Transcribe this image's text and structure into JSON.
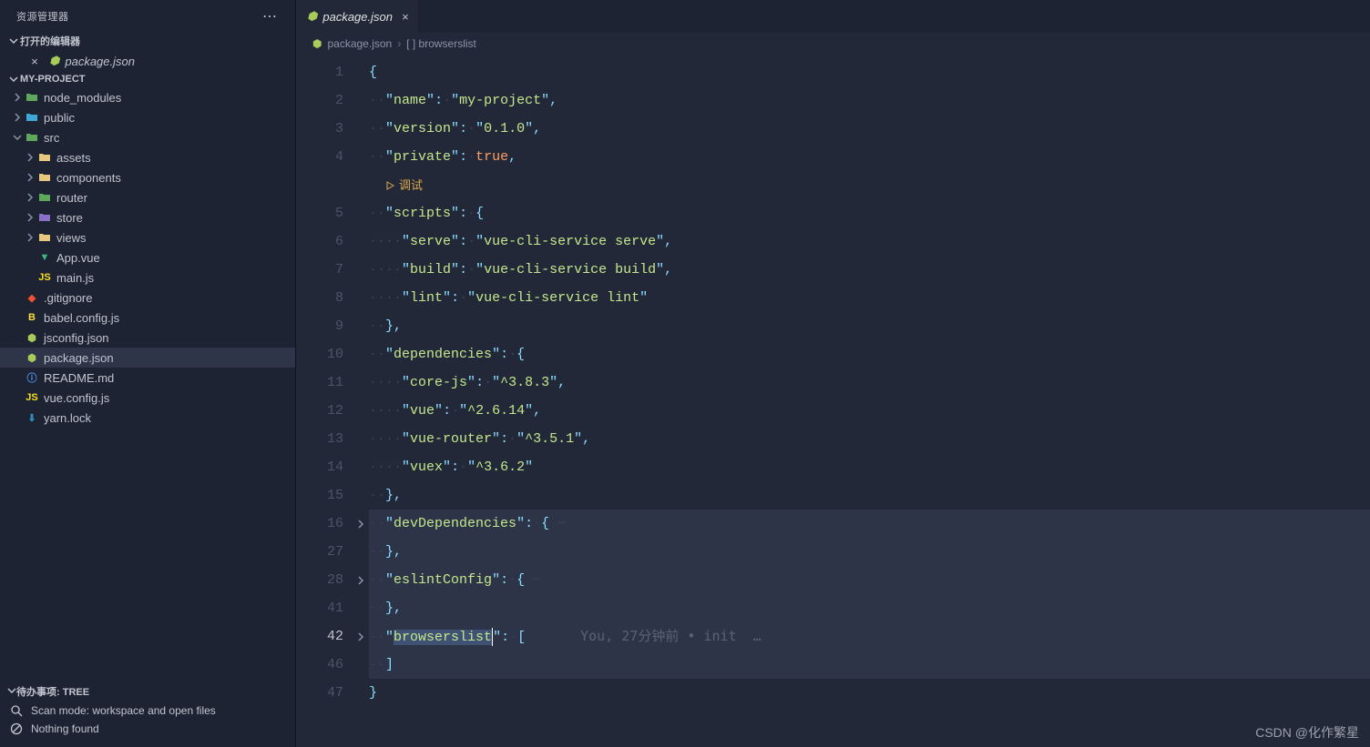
{
  "sidebar": {
    "title": "资源管理器",
    "open_editors_label": "打开的编辑器",
    "open_editors": [
      {
        "label": "package.json"
      }
    ],
    "project_label": "MY-PROJECT",
    "tree": [
      {
        "label": "node_modules",
        "depth": 1,
        "kind": "folder",
        "iconCls": "icon-folder-g",
        "expanded": false
      },
      {
        "label": "public",
        "depth": 1,
        "kind": "folder",
        "iconCls": "icon-folder",
        "expanded": false
      },
      {
        "label": "src",
        "depth": 1,
        "kind": "folder",
        "iconCls": "icon-folder-g",
        "expanded": true
      },
      {
        "label": "assets",
        "depth": 2,
        "kind": "folder",
        "iconCls": "icon-folder-o",
        "expanded": false
      },
      {
        "label": "components",
        "depth": 2,
        "kind": "folder",
        "iconCls": "icon-folder-o",
        "expanded": false
      },
      {
        "label": "router",
        "depth": 2,
        "kind": "folder",
        "iconCls": "icon-folder-g",
        "expanded": false
      },
      {
        "label": "store",
        "depth": 2,
        "kind": "folder",
        "iconCls": "icon-folder-v",
        "expanded": false
      },
      {
        "label": "views",
        "depth": 2,
        "kind": "folder",
        "iconCls": "icon-folder-o",
        "expanded": false
      },
      {
        "label": "App.vue",
        "depth": 2,
        "kind": "file",
        "iconCls": "icon-vue"
      },
      {
        "label": "main.js",
        "depth": 2,
        "kind": "file",
        "iconCls": "icon-js"
      },
      {
        "label": ".gitignore",
        "depth": 1,
        "kind": "file",
        "iconCls": "icon-git"
      },
      {
        "label": "babel.config.js",
        "depth": 1,
        "kind": "file",
        "iconCls": "icon-babel"
      },
      {
        "label": "jsconfig.json",
        "depth": 1,
        "kind": "file",
        "iconCls": "icon-json"
      },
      {
        "label": "package.json",
        "depth": 1,
        "kind": "file",
        "iconCls": "icon-json",
        "selected": true
      },
      {
        "label": "README.md",
        "depth": 1,
        "kind": "file",
        "iconCls": "icon-md"
      },
      {
        "label": "vue.config.js",
        "depth": 1,
        "kind": "file",
        "iconCls": "icon-js"
      },
      {
        "label": "yarn.lock",
        "depth": 1,
        "kind": "file",
        "iconCls": "icon-yarn"
      }
    ],
    "footer": {
      "todo_label": "待办事项: TREE",
      "scan_label": "Scan mode: workspace and open files",
      "nothing_label": "Nothing found"
    }
  },
  "tabs": [
    {
      "label": "package.json"
    }
  ],
  "breadcrumb": {
    "file": "package.json",
    "path": "[ ] browserslist"
  },
  "codelens": {
    "debug": "调试"
  },
  "blame": {
    "text": "You, 27分钟前 • init  …"
  },
  "code": {
    "lines": [
      {
        "n": 1,
        "type": "brace",
        "text": "{"
      },
      {
        "n": 2,
        "type": "kv",
        "indent": 1,
        "key": "name",
        "val": "my-project",
        "comma": true
      },
      {
        "n": 3,
        "type": "kv",
        "indent": 1,
        "key": "version",
        "val": "0.1.0",
        "comma": true
      },
      {
        "n": 4,
        "type": "kvkw",
        "indent": 1,
        "key": "private",
        "kw": "true",
        "comma": true
      },
      {
        "n": 0,
        "type": "lens"
      },
      {
        "n": 5,
        "type": "kobj",
        "indent": 1,
        "key": "scripts"
      },
      {
        "n": 6,
        "type": "kv",
        "indent": 2,
        "key": "serve",
        "val": "vue-cli-service serve",
        "comma": true
      },
      {
        "n": 7,
        "type": "kv",
        "indent": 2,
        "key": "build",
        "val": "vue-cli-service build",
        "comma": true
      },
      {
        "n": 8,
        "type": "kv",
        "indent": 2,
        "key": "lint",
        "val": "vue-cli-service lint"
      },
      {
        "n": 9,
        "type": "close",
        "indent": 1,
        "text": "},",
        "comma": true
      },
      {
        "n": 10,
        "type": "kobj",
        "indent": 1,
        "key": "dependencies"
      },
      {
        "n": 11,
        "type": "kv",
        "indent": 2,
        "key": "core-js",
        "val": "^3.8.3",
        "comma": true
      },
      {
        "n": 12,
        "type": "kv",
        "indent": 2,
        "key": "vue",
        "val": "^2.6.14",
        "comma": true
      },
      {
        "n": 13,
        "type": "kv",
        "indent": 2,
        "key": "vue-router",
        "val": "^3.5.1",
        "comma": true
      },
      {
        "n": 14,
        "type": "kv",
        "indent": 2,
        "key": "vuex",
        "val": "^3.6.2"
      },
      {
        "n": 15,
        "type": "close",
        "indent": 1,
        "text": "},",
        "comma": true
      },
      {
        "n": 16,
        "type": "kobjfold",
        "indent": 1,
        "key": "devDependencies",
        "fold": true,
        "hl": true
      },
      {
        "n": 27,
        "type": "close",
        "indent": 1,
        "text": "},",
        "comma": true,
        "hl": true
      },
      {
        "n": 28,
        "type": "kobjfold",
        "indent": 1,
        "key": "eslintConfig",
        "fold": true,
        "hl": true
      },
      {
        "n": 41,
        "type": "close",
        "indent": 1,
        "text": "},",
        "comma": true,
        "hl": true
      },
      {
        "n": 42,
        "type": "karr",
        "indent": 1,
        "key": "browserslist",
        "fold": true,
        "hl": true,
        "cursor": true,
        "blame": true
      },
      {
        "n": 46,
        "type": "closearr",
        "indent": 1,
        "text": "]",
        "hl": true
      },
      {
        "n": 47,
        "type": "brace",
        "text": "}"
      }
    ]
  },
  "watermark": "CSDN @化作繁星"
}
